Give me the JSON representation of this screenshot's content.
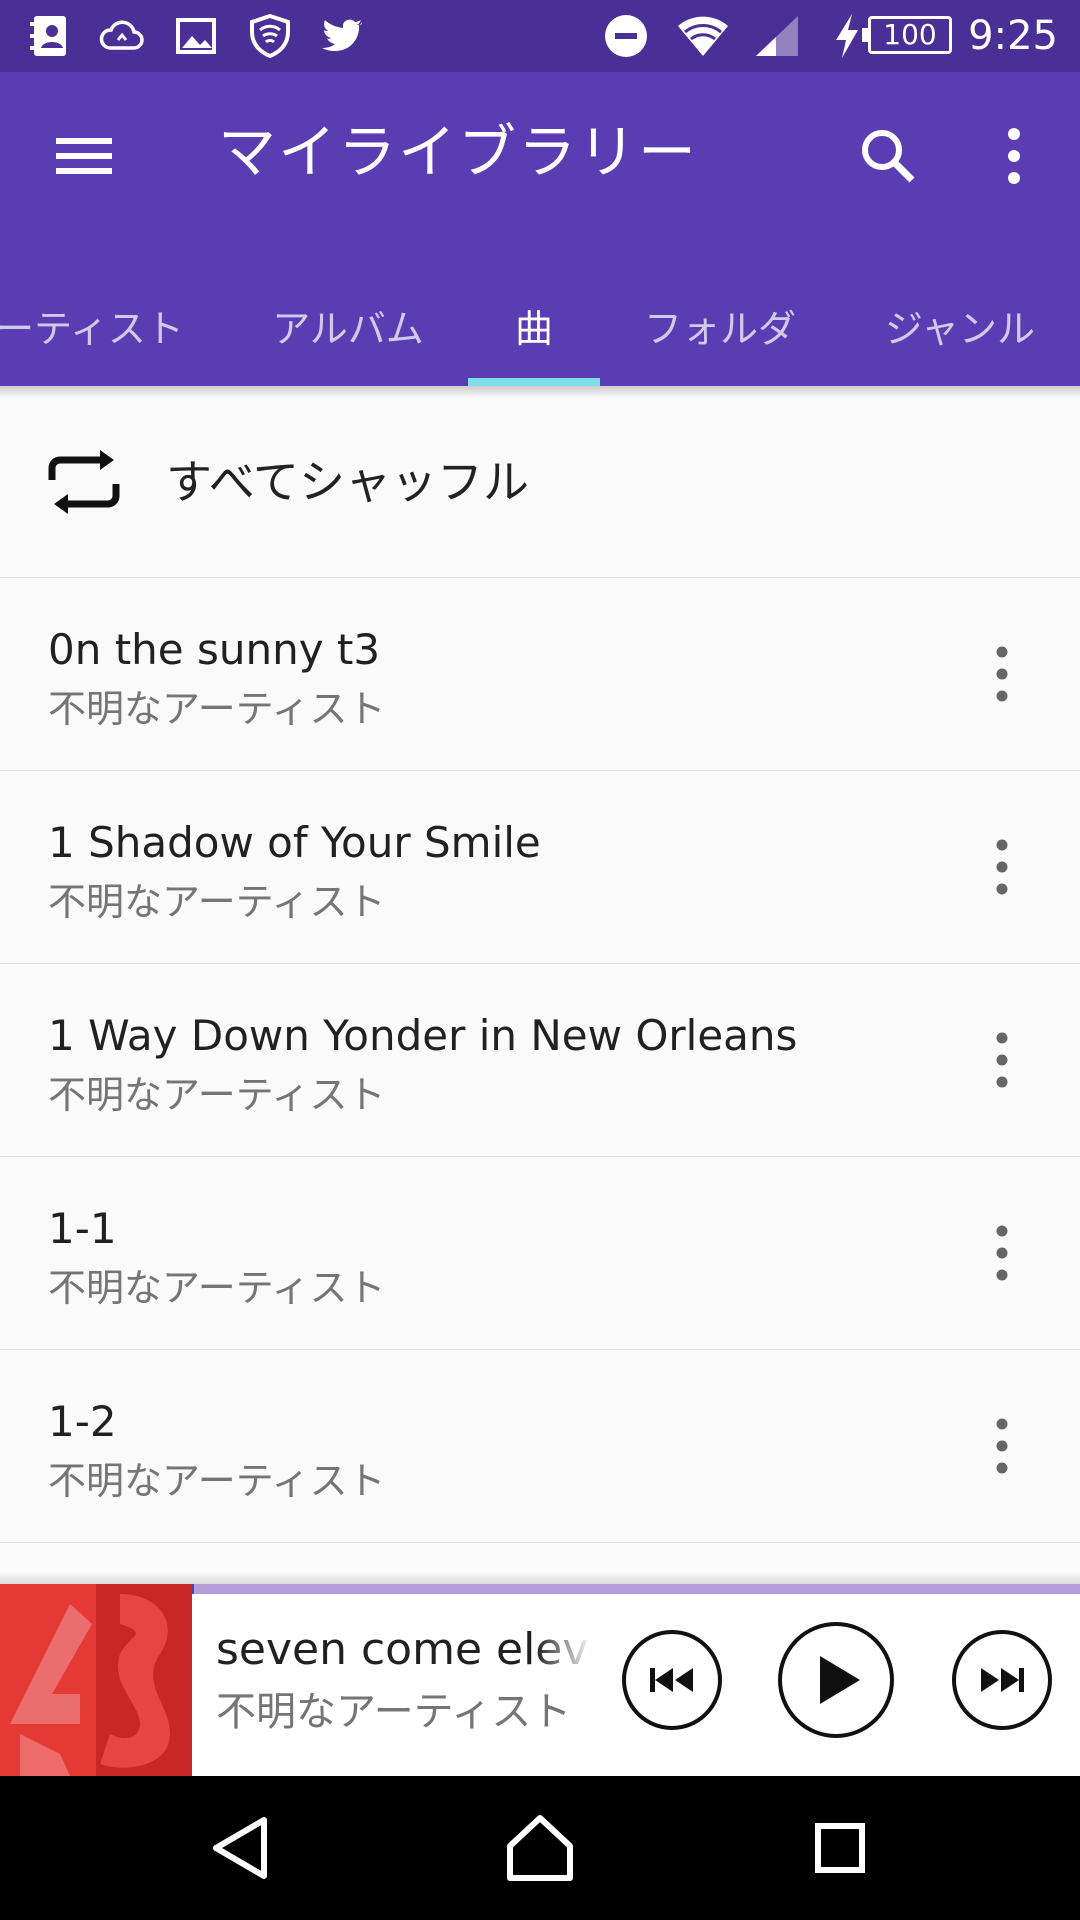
{
  "status_bar": {
    "time": "9:25",
    "battery": "100",
    "icons": [
      "contacts-icon",
      "cloud-sync-icon",
      "image-icon",
      "shield-icon",
      "twitter-icon",
      "do-not-disturb-icon",
      "wifi-icon",
      "signal-icon",
      "charging-icon",
      "battery-icon"
    ]
  },
  "app_bar": {
    "title": "マイライブラリー",
    "color": "#5b3db3",
    "status_color": "#4a2f96",
    "indicator_color": "#80deea"
  },
  "tabs": [
    {
      "label": "ーティスト",
      "active": false
    },
    {
      "label": "アルバム",
      "active": false
    },
    {
      "label": "曲",
      "active": true
    },
    {
      "label": "フォルダ",
      "active": false
    },
    {
      "label": "ジャンル",
      "active": false
    }
  ],
  "shuffle": {
    "label": "すべてシャッフル"
  },
  "songs": [
    {
      "title": "0n the sunny t3",
      "artist": "不明なアーティスト"
    },
    {
      "title": "1 Shadow of Your Smile",
      "artist": "不明なアーティスト"
    },
    {
      "title": "1 Way Down Yonder in New Orleans",
      "artist": "不明なアーティスト"
    },
    {
      "title": "1-1",
      "artist": "不明なアーティスト"
    },
    {
      "title": "1-2",
      "artist": "不明なアーティスト"
    }
  ],
  "mini_player": {
    "title": "seven come eleven",
    "artist": "不明なアーティスト",
    "progress": 0.18,
    "art_color": "#d32f2f"
  },
  "nav_bar": {
    "buttons": [
      "back-icon",
      "home-icon",
      "recents-icon"
    ]
  }
}
